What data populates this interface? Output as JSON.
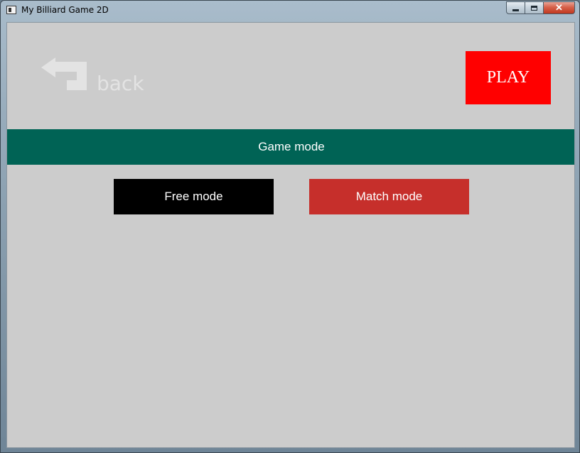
{
  "window": {
    "title": "My Billiard Game 2D",
    "close_glyph": "✕"
  },
  "nav": {
    "back_label": "back",
    "back_icon": "back-arrow-icon"
  },
  "actions": {
    "play_label": "PLAY"
  },
  "game_mode": {
    "header": "Game mode",
    "options": [
      {
        "label": "Free mode",
        "color": "#000000"
      },
      {
        "label": "Match mode",
        "color": "#c62f2b"
      }
    ]
  },
  "colors": {
    "background": "#cccccc",
    "header": "#006355",
    "play": "#ff0000"
  }
}
